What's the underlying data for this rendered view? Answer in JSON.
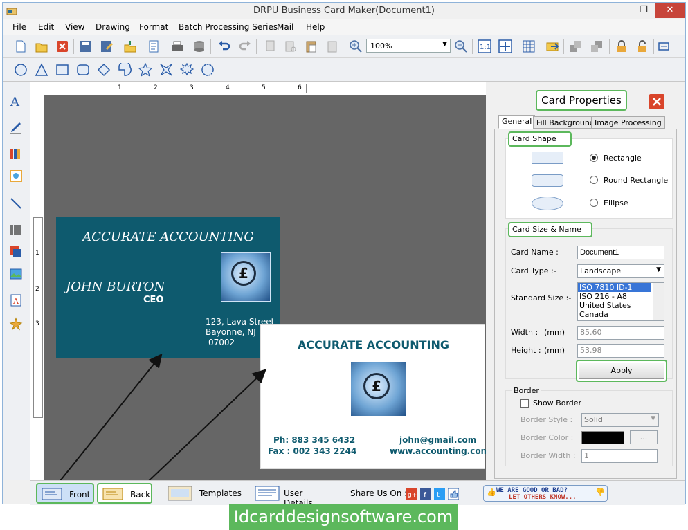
{
  "window": {
    "title": "DRPU Business Card Maker(Document1)",
    "minimize": "–",
    "restore": "❐",
    "close": "✕"
  },
  "menu": [
    {
      "label": "File"
    },
    {
      "label": "Edit"
    },
    {
      "label": "View"
    },
    {
      "label": "Drawing"
    },
    {
      "label": "Format"
    },
    {
      "label": "Batch Processing Series"
    },
    {
      "label": "Mail"
    },
    {
      "label": "Help"
    }
  ],
  "toolbar": {
    "zoom_value": "100%"
  },
  "ruler": {
    "h_marks": [
      "1",
      "2",
      "3",
      "4",
      "5",
      "6"
    ],
    "v_marks": [
      "1",
      "2",
      "3"
    ]
  },
  "front_card": {
    "company": "ACCURATE ACCOUNTING",
    "name": "JOHN BURTON",
    "title": "CEO",
    "address1": "123, Lava Street",
    "address2": "Bayonne, NJ",
    "address3": "07002",
    "logo_symbol": "£"
  },
  "back_card": {
    "company": "ACCURATE ACCOUNTING",
    "phone": "Ph: 883 345 6432",
    "fax": "Fax : 002 343 2244",
    "email": "john@gmail.com",
    "web": "www.accounting.com",
    "logo_symbol": "£"
  },
  "properties": {
    "title": "Card Properties",
    "tabs": [
      "General",
      "Fill Background",
      "Image Processing"
    ],
    "card_shape_label": "Card Shape",
    "shapes": [
      {
        "label": "Rectangle",
        "selected": true
      },
      {
        "label": "Round Rectangle",
        "selected": false
      },
      {
        "label": "Ellipse",
        "selected": false
      }
    ],
    "size_name_label": "Card Size & Name",
    "card_name_label": "Card Name :",
    "card_name_value": "Document1",
    "card_type_label": "Card Type :-",
    "card_type_value": "Landscape",
    "standard_size_label": "Standard Size :-",
    "standard_sizes": [
      "ISO 7810 ID-1",
      "ISO 216 - A8",
      "United States",
      "Canada"
    ],
    "width_label": "Width :",
    "width_unit": "(mm)",
    "width_value": "85.60",
    "height_label": "Height :",
    "height_unit": "(mm)",
    "height_value": "53.98",
    "apply_label": "Apply",
    "border_label": "Border",
    "show_border_label": "Show Border",
    "border_style_label": "Border Style :",
    "border_style_value": "Solid",
    "border_color_label": "Border Color :",
    "border_color_btn": "...",
    "border_width_label": "Border Width :",
    "border_width_value": "1"
  },
  "bottom": {
    "front": "Front",
    "back": "Back",
    "templates": "Templates",
    "user_details": "User Details",
    "share": "Share Us On :",
    "feedback_line1": "WE ARE GOOD OR BAD?",
    "feedback_line2": "LET OTHERS KNOW..."
  },
  "site_banner": "Idcarddesignsoftware.com",
  "colors": {
    "accent_green": "#5cb85c",
    "card_teal": "#0e5a6e",
    "close_red": "#c7443a"
  }
}
